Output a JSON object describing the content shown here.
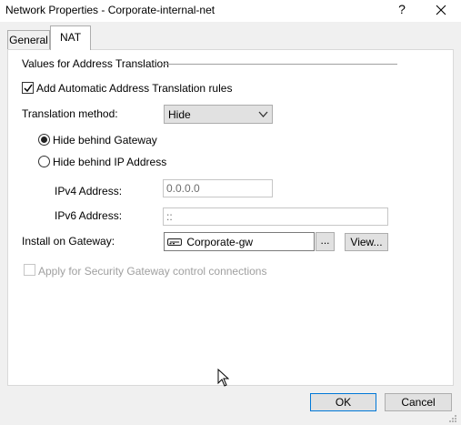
{
  "window": {
    "title": "Network Properties - Corporate-internal-net",
    "help_label": "?"
  },
  "tabs": [
    {
      "label": "General",
      "active": false
    },
    {
      "label": "NAT",
      "active": true
    }
  ],
  "nat": {
    "group_label": "Values for Address Translation",
    "auto_rules": {
      "label": "Add Automatic Address Translation rules",
      "checked": true
    },
    "translation_method": {
      "label": "Translation method:",
      "value": "Hide"
    },
    "hide_gateway": {
      "label": "Hide behind Gateway",
      "selected": true
    },
    "hide_ip": {
      "label": "Hide behind IP Address",
      "selected": false
    },
    "ipv4": {
      "label": "IPv4 Address:",
      "value": "0.0.0.0"
    },
    "ipv6": {
      "label": "IPv6 Address:",
      "value": "::"
    },
    "install_gateway": {
      "label": "Install on Gateway:",
      "value": "Corporate-gw",
      "browse_label": "...",
      "view_label": "View..."
    },
    "apply_security": {
      "label": "Apply for Security Gateway control connections",
      "checked": false,
      "enabled": false
    }
  },
  "footer": {
    "ok_label": "OK",
    "cancel_label": "Cancel"
  },
  "colors": {
    "accent": "#0078d7",
    "panel_bg": "#ffffff",
    "dialog_bg": "#f0f0f0"
  }
}
